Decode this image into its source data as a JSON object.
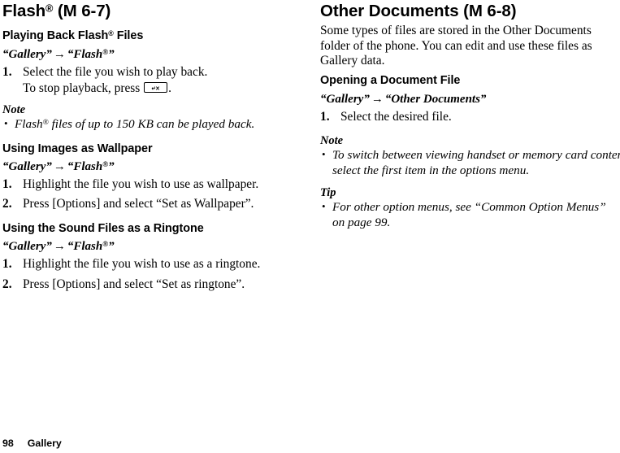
{
  "footer": {
    "page_number": "98",
    "chapter": "Gallery"
  },
  "left_column": {
    "title": {
      "text_before": "Flash",
      "registered": "®",
      "text_after": " (M 6-7)"
    },
    "sections": [
      {
        "heading_before": "Playing Back Flash",
        "heading_registered": "®",
        "heading_after": " Files",
        "navpath": {
          "from": "“Gallery”",
          "arrow": "→",
          "to_before": "“Flash",
          "to_registered": "®",
          "to_after": "”"
        },
        "steps": [
          {
            "num": "1.",
            "text": "Select the file you wish to play back.",
            "sub_before": "To stop playback, press ",
            "key_glyph": "↵✕",
            "sub_after": "."
          }
        ],
        "callouts": [
          {
            "label": "Note",
            "bullet": "•",
            "item_before": "Flash",
            "item_registered": "®",
            "item_after": " files of up to 150 KB can be played back."
          }
        ]
      },
      {
        "heading": "Using Images as Wallpaper",
        "navpath": {
          "from": "“Gallery”",
          "arrow": "→",
          "to_before": "“Flash",
          "to_registered": "®",
          "to_after": "”"
        },
        "steps": [
          {
            "num": "1.",
            "text": "Highlight the file you wish to use as wallpaper."
          },
          {
            "num": "2.",
            "text": "Press [Options] and select “Set as Wallpaper”."
          }
        ]
      },
      {
        "heading": "Using the Sound Files as a Ringtone",
        "navpath": {
          "from": "“Gallery”",
          "arrow": "→",
          "to_before": "“Flash",
          "to_registered": "®",
          "to_after": "”"
        },
        "steps": [
          {
            "num": "1.",
            "text": "Highlight the file you wish to use as a ringtone."
          },
          {
            "num": "2.",
            "text": "Press [Options] and select “Set as ringtone”."
          }
        ]
      }
    ]
  },
  "right_column": {
    "title": "Other Documents (M 6-8)",
    "intro": "Some types of files are stored in the Other Documents folder of the phone. You can edit and use these files as Gallery data.",
    "sections": [
      {
        "heading": "Opening a Document File",
        "navpath": {
          "from": "“Gallery”",
          "arrow": "→",
          "to": "“Other Documents”"
        },
        "steps": [
          {
            "num": "1.",
            "text": "Select the desired file."
          }
        ],
        "callouts": [
          {
            "label": "Note",
            "bullet": "•",
            "item": "To switch between viewing handset or memory card content, select the first item in the options menu."
          },
          {
            "label": "Tip",
            "bullet": "•",
            "item": "For other option menus, see “Common Option Menus” on page 99."
          }
        ]
      }
    ]
  }
}
